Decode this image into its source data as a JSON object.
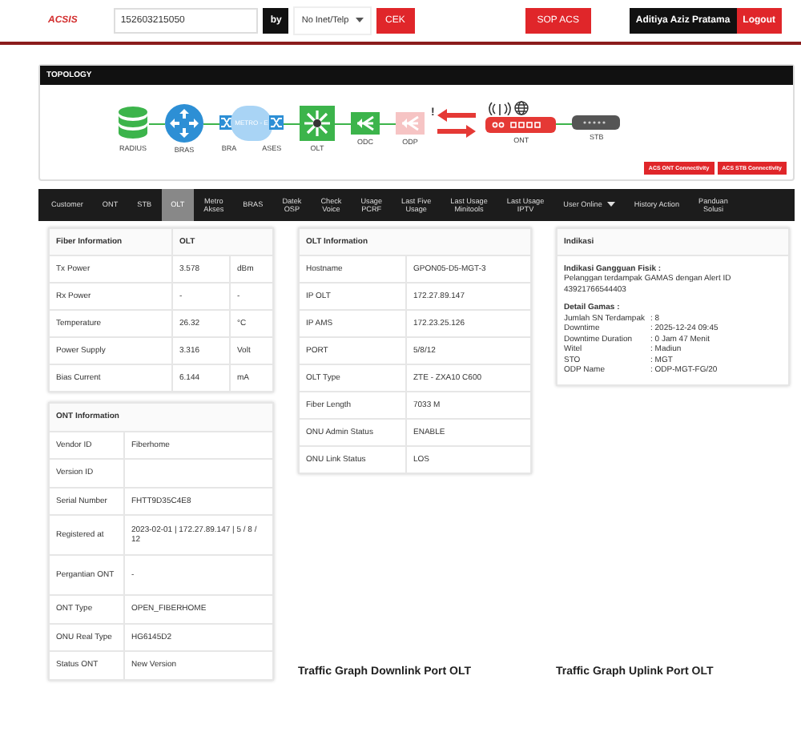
{
  "header": {
    "logo": "ACSIS",
    "search_value": "152603215050",
    "by_label": "by",
    "select_value": "No Inet/Telp",
    "check_button": "CEK",
    "sop_button": "SOP ACS",
    "user": "Aditiya Aziz Pratama",
    "logout": "Logout"
  },
  "topology": {
    "title": "TOPOLOGY",
    "nodes": [
      {
        "kind": "database",
        "label": "RADIUS",
        "color": "#3cb44b"
      },
      {
        "kind": "router",
        "label": "BRAS",
        "color": "#2d8fd5"
      },
      {
        "kind": "metro",
        "label": "METRO - E",
        "left_label": "BRA",
        "right_label": "ASES",
        "color": "#2d8fd5"
      },
      {
        "kind": "olt",
        "label": "OLT",
        "color": "#3cb44b"
      },
      {
        "kind": "splitter",
        "label": "ODC",
        "color": "#3cb44b"
      },
      {
        "kind": "splitter",
        "label": "ODP",
        "color": "#f6c4c4",
        "alert_link": true,
        "alert_mark": "!"
      },
      {
        "kind": "ont",
        "label": "ONT",
        "color": "#e53935"
      },
      {
        "kind": "stb",
        "label": "STB",
        "color": "#555555"
      }
    ],
    "buttons": [
      "ACS ONT Connectivity",
      "ACS STB Connectivity"
    ]
  },
  "tabs": [
    {
      "label": "Customer",
      "selected": false
    },
    {
      "label": "ONT",
      "selected": false
    },
    {
      "label": "STB",
      "selected": false
    },
    {
      "label": "OLT",
      "selected": true
    },
    {
      "label": "Metro\nAkses",
      "selected": false
    },
    {
      "label": "BRAS",
      "selected": false
    },
    {
      "label": "Datek\nOSP",
      "selected": false
    },
    {
      "label": "Check\nVoice",
      "selected": false
    },
    {
      "label": "Usage\nPCRF",
      "selected": false
    },
    {
      "label": "Last Five\nUsage",
      "selected": false
    },
    {
      "label": "Last Usage\nMinitools",
      "selected": false
    },
    {
      "label": "Last Usage\nIPTV",
      "selected": false
    },
    {
      "label": "User Online",
      "selected": false,
      "has_menu": true
    },
    {
      "label": "History Action",
      "selected": false
    },
    {
      "label": "Panduan\nSolusi",
      "selected": false
    }
  ],
  "fiber_information": {
    "columns": [
      "Fiber Information",
      "OLT"
    ],
    "rows": [
      [
        "Tx Power",
        "3.578",
        "dBm"
      ],
      [
        "Rx Power",
        "-",
        "-"
      ],
      [
        "Temperature",
        "26.32",
        "°C"
      ],
      [
        "Power Supply",
        "3.316",
        "Volt"
      ],
      [
        "Bias Current",
        "6.144",
        "mA"
      ]
    ]
  },
  "ont_information": {
    "title": "ONT Information",
    "rows": [
      [
        "Vendor ID",
        "Fiberhome"
      ],
      [
        "Version ID",
        null
      ],
      [
        "Serial Number",
        "FHTT9D35C4E8"
      ],
      [
        "Registered at",
        "2023-02-01 | 172.27.89.147 | 5 / 8 / 12"
      ],
      [
        "Pergantian ONT",
        "-"
      ],
      [
        "ONT Type",
        "OPEN_FIBERHOME"
      ],
      [
        "ONU Real Type",
        "HG6145D2"
      ],
      [
        "Status ONT",
        "New Version"
      ]
    ]
  },
  "olt_information": {
    "title": "OLT Information",
    "rows": [
      [
        "Hostname",
        "GPON05-D5-MGT-3"
      ],
      [
        "IP OLT",
        "172.27.89.147"
      ],
      [
        "IP AMS",
        "172.23.25.126"
      ],
      [
        "PORT",
        "5/8/12"
      ],
      [
        "OLT Type",
        "ZTE - ZXA10 C600"
      ],
      [
        "Fiber Length",
        "7033 M"
      ],
      [
        "ONU Admin Status",
        "ENABLE"
      ],
      [
        "ONU Link Status",
        "LOS"
      ]
    ]
  },
  "indikasi": {
    "title": "Indikasi",
    "heading": "Indikasi Gangguan Fisik :",
    "message": "Pelanggan terdampak GAMAS dengan Alert ID 43921766544403",
    "detail_heading": "Detail Gamas :",
    "details": [
      [
        "Jumlah SN Terdampak",
        ": 8"
      ],
      [
        "Downtime",
        ": 2025-12-24 09:45"
      ],
      [
        "Downtime Duration",
        ": 0 Jam 47 Menit"
      ],
      [
        "Witel",
        ": Madiun"
      ],
      [
        "STO",
        ": MGT"
      ],
      [
        "ODP Name",
        ": ODP-MGT-FG/20"
      ]
    ]
  },
  "traffic_titles": [
    "Traffic Graph Downlink Port OLT",
    "Traffic Graph Uplink Port OLT"
  ]
}
